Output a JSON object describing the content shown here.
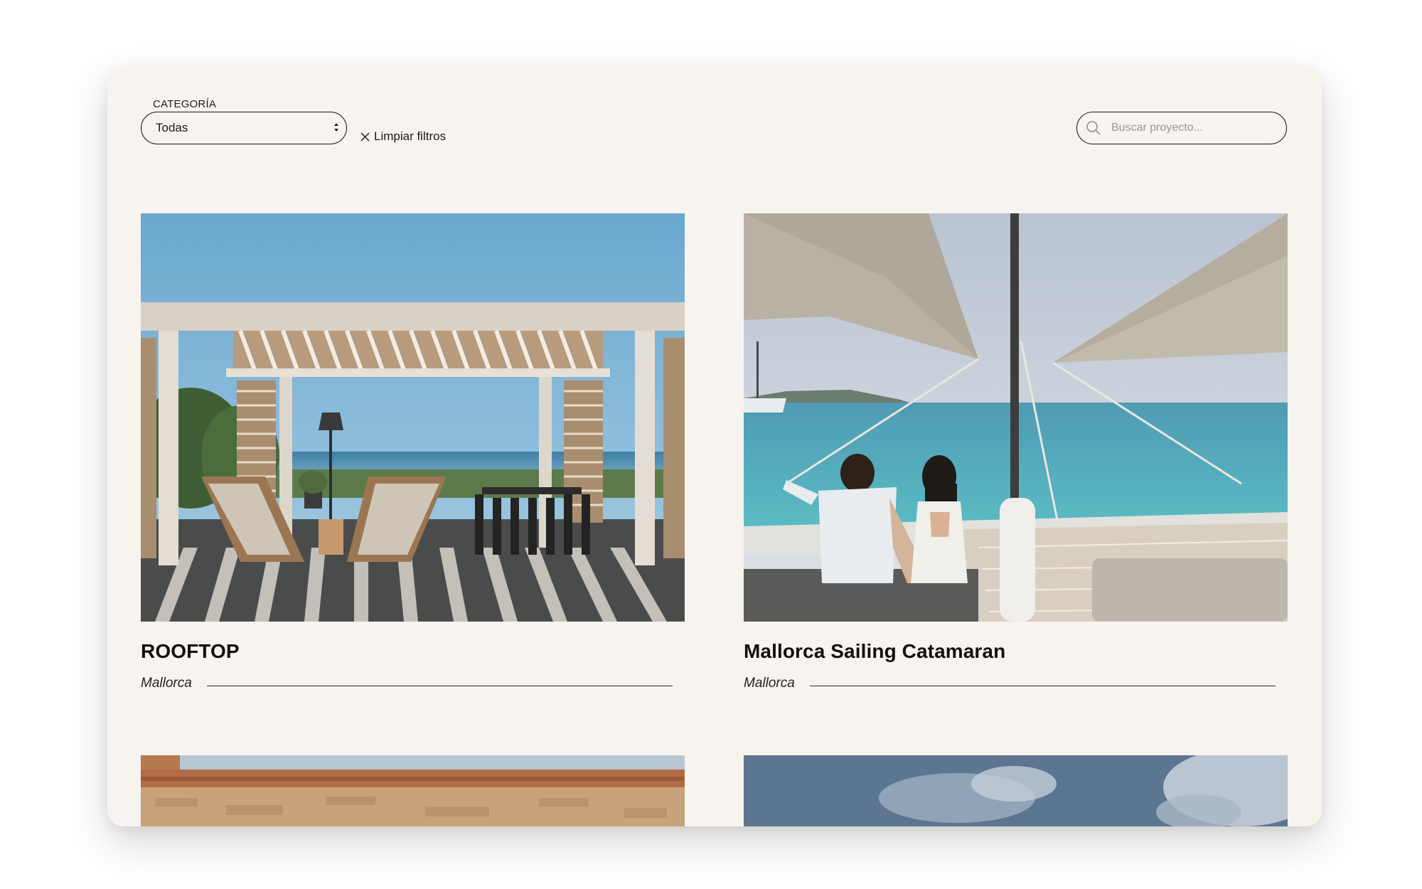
{
  "filters": {
    "category_label": "CATEGORÍA",
    "category_selected": "Todas",
    "clear_label": "Limpiar filtros"
  },
  "search": {
    "placeholder": "Buscar proyecto..."
  },
  "projects": [
    {
      "title": "ROOFTOP",
      "location": "Mallorca"
    },
    {
      "title": "Mallorca Sailing Catamaran",
      "location": "Mallorca"
    }
  ],
  "colors": {
    "background": "#f7f3ef",
    "text": "#111111",
    "border": "#1a1a1a"
  },
  "icons": {
    "select_arrows": "chevron-up-down-icon",
    "clear": "close-icon",
    "search": "search-icon"
  }
}
